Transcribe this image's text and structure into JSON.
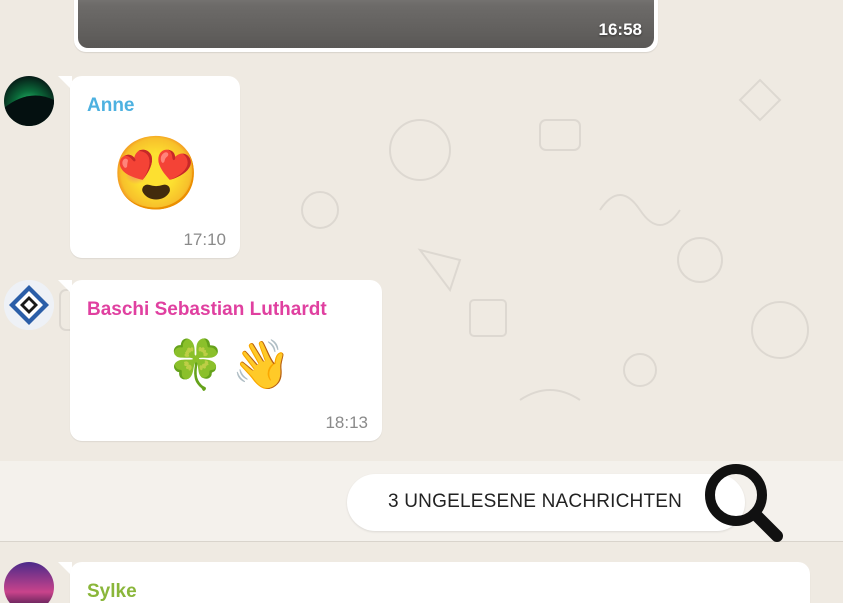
{
  "photo_message": {
    "time": "16:58"
  },
  "messages": [
    {
      "sender": "Anne",
      "sender_color": "#4db1e0",
      "content": "😍",
      "time": "17:10"
    },
    {
      "sender": "Baschi Sebastian Luthardt",
      "sender_color": "#e040a0",
      "content": "🍀👋",
      "time": "18:13"
    },
    {
      "sender": "Sylke",
      "sender_color": "#8ab63a"
    }
  ],
  "unread_banner": {
    "label": "3 UNGELESENE NACHRICHTEN"
  },
  "icons": {
    "zoom": "magnifier-icon"
  }
}
